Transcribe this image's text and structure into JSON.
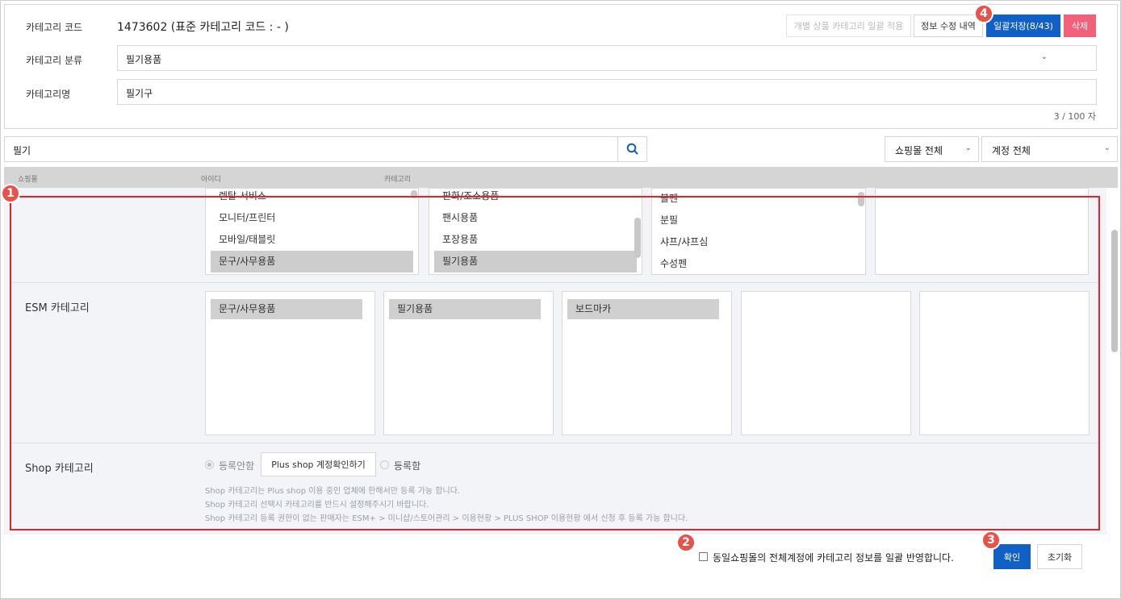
{
  "info": {
    "code_label": "카테고리 코드",
    "code_value": "1473602 (표준 카테고리 코드 : - )",
    "classification_label": "카테고리 분류",
    "classification_value": "필기용품",
    "name_label": "카테고리명",
    "name_value": "필기구",
    "counter": "3 / 100 자"
  },
  "toolbar": {
    "bulk_apply_label": "개별 상품 카테고리 일괄 적용",
    "history_label": "정보 수정 내역",
    "save_all_label": "일괄저장(8/43)",
    "delete_label": "삭제"
  },
  "search": {
    "value": "필기",
    "mall_filter": "쇼핑몰 전체",
    "account_filter": "계정 전체"
  },
  "grid_header": {
    "col_mall": "쇼핑몰",
    "col_id": "아이디",
    "col_category": "카테고리"
  },
  "mall_category": {
    "col1": [
      "렌탈 서비스",
      "모니터/프린터",
      "모바일/태블릿",
      "문구/사무용품"
    ],
    "col2": [
      "판화/조소용품",
      "팬시용품",
      "포장용품",
      "필기용품"
    ],
    "col3": [
      "볼펜",
      "분필",
      "샤프/샤프심",
      "수성펜"
    ]
  },
  "esm": {
    "label": "ESM 카테고리",
    "selections": [
      "문구/사무용품",
      "필기용품",
      "보드마카"
    ]
  },
  "shop": {
    "label": "Shop 카테고리",
    "opt_not_registered": "등록안함",
    "check_account_btn": "Plus shop 계정확인하기",
    "opt_registered": "등록함",
    "help1": "Shop 카테고리는 Plus shop 이용 중인 업체에 한해서만 등록 가능 합니다.",
    "help2": "Shop 카테고리 선택시 카테고리를 반드시 설정해주시기 바랍니다.",
    "help3": "Shop 카테고리 등록 권한이 없는 판매자는 ESM+ > 미니샵/스토어관리 > 이용현황 > PLUS SHOP 이용현황 에서 신청 후 등록 가능 합니다."
  },
  "footer": {
    "apply_all_label": "동일쇼핑몰의 전체계정에 카테고리 정보를 일괄 반영합니다.",
    "confirm_label": "확인",
    "reset_label": "초기화"
  },
  "badges": [
    "1",
    "2",
    "3",
    "4"
  ],
  "colors": {
    "primary": "#1060c8",
    "danger": "#f2607a",
    "annotation": "#e8202a",
    "badge": "#e5534b"
  }
}
